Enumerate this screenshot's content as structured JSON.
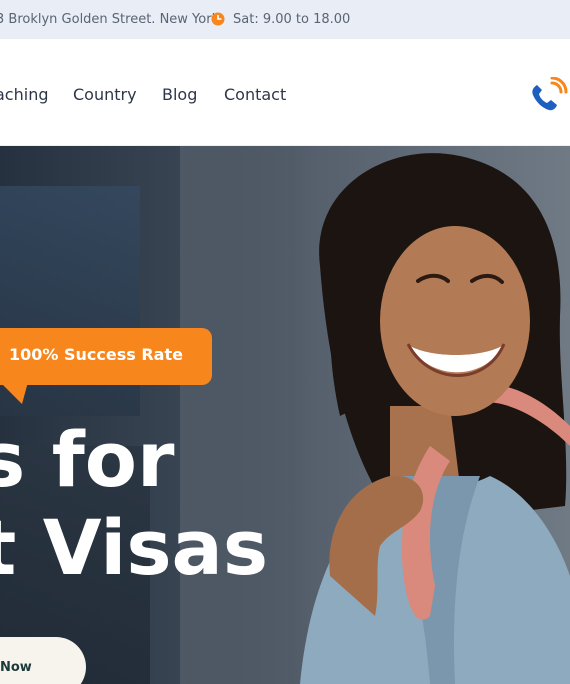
{
  "topbar": {
    "address": "3 Broklyn Golden Street. New York",
    "hours": "Sat: 9.00 to 18.00",
    "clock_icon": "clock-icon"
  },
  "nav": {
    "items": [
      "aching",
      "Country",
      "Blog",
      "Contact"
    ],
    "phone_icon": "phone-icon"
  },
  "hero": {
    "badge": "100% Success Rate",
    "title_line1": "s for",
    "title_line2": "t Visas",
    "cta_label": "Now"
  },
  "colors": {
    "accent": "#f7861c",
    "brand_blue": "#1f5fbf",
    "topbar_bg": "#e9edf5",
    "nav_text": "#2e3748"
  }
}
